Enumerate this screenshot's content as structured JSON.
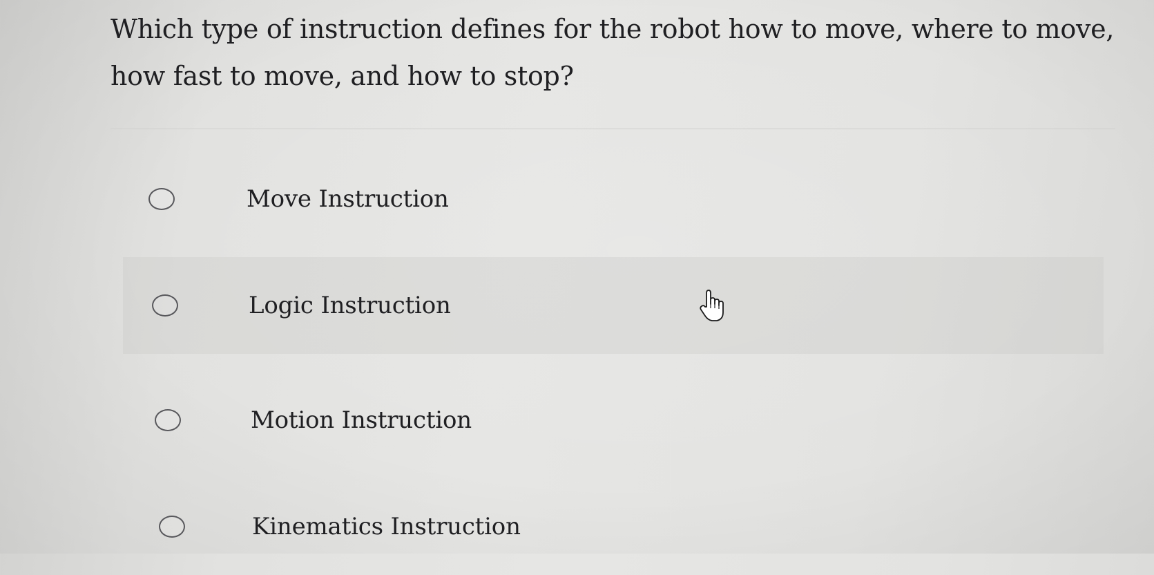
{
  "question": {
    "text": "Which type of instruction defines for the robot how to move, where to move, how fast to move, and how to stop?"
  },
  "options": [
    {
      "label": "Move Instruction"
    },
    {
      "label": "Logic Instruction"
    },
    {
      "label": "Motion Instruction"
    },
    {
      "label": "Kinematics Instruction"
    }
  ],
  "cursor": {
    "icon": "hand-pointer-icon"
  }
}
